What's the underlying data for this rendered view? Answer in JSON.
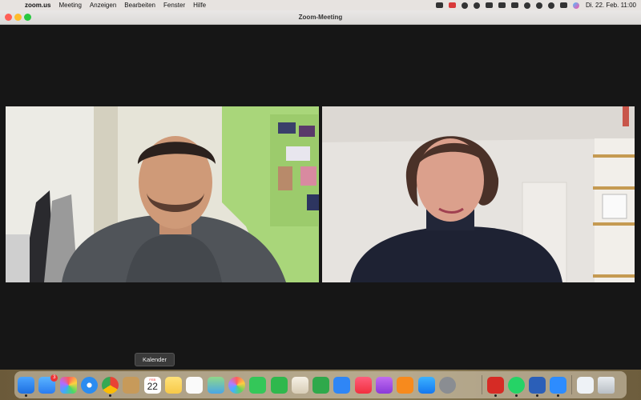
{
  "menubar": {
    "app_name": "zoom.us",
    "items": [
      "Meeting",
      "Anzeigen",
      "Bearbeiten",
      "Fenster",
      "Hilfe"
    ],
    "clock": "Di. 22. Feb.  11:00"
  },
  "window": {
    "title": "Zoom-Meeting"
  },
  "tooltip": {
    "label": "Kalender"
  },
  "dock": {
    "calendar_month": "FEB",
    "calendar_day": "22",
    "mail_badge": "3"
  },
  "colors": {
    "menubar_bg": "#e7e3e0",
    "window_bg": "#161616",
    "traffic_close": "#ff5f57",
    "traffic_min": "#febc2e",
    "traffic_max": "#28c840"
  }
}
